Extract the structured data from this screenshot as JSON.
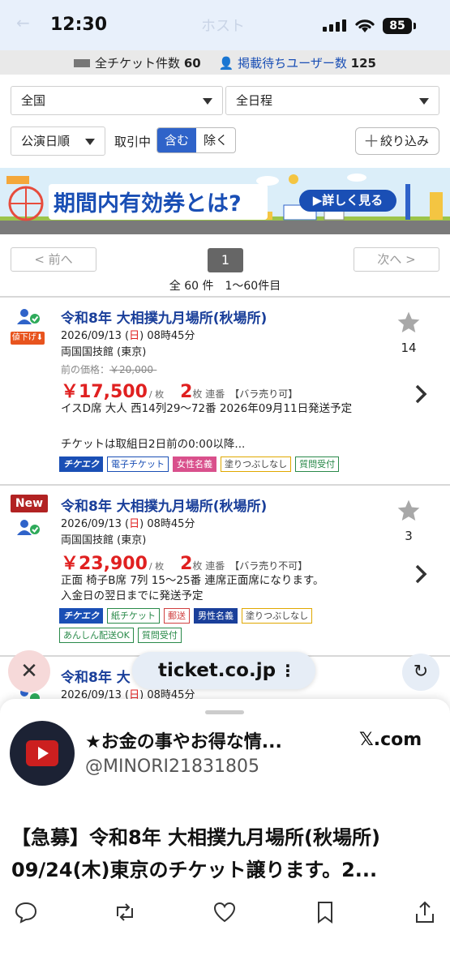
{
  "status_bar": {
    "time": "12:30",
    "battery": "85",
    "ghost_title": "ホスト"
  },
  "counts": {
    "total_label": "全チケット件数",
    "total": "60",
    "waiting_label": "掲載待ちユーザー数",
    "waiting": "125"
  },
  "filters": {
    "region": "全国",
    "schedule": "全日程",
    "sort": "公演日順",
    "trading_label": "取引中",
    "include": "含む",
    "exclude": "除く",
    "narrow": "絞り込み"
  },
  "banner": {
    "text": "期間内有効券とは?",
    "cta": "▶詳しく見る"
  },
  "pagination": {
    "prev": "< 前へ",
    "next": "次へ >",
    "page": "1",
    "info": "全 60 件　1〜60件目"
  },
  "listings": [
    {
      "badge": "値下げ⬇",
      "title": "令和8年 大相撲九月場所(秋場所)",
      "date": "2026/09/13 (",
      "day": "日",
      "time": ") 08時45分",
      "venue": "両国国技館 (東京)",
      "prev_label": "前の価格：",
      "prev_price": "￥20,000-",
      "price": "￥17,500",
      "per": "/ 枚",
      "qty": "2",
      "qty_unit": "枚 連番",
      "bara": "【バラ売り可】",
      "desc1": "イスD席 大人 西14列29〜72番 2026年09月11日発送予定",
      "desc2": "チケットは取組日2日前の0:00以降...",
      "tags": [
        {
          "label": "チケエク",
          "kind": "brand"
        },
        {
          "label": "電子チケット",
          "kind": "blue"
        },
        {
          "label": "女性名義",
          "kind": "pink"
        },
        {
          "label": "塗りつぶしなし",
          "kind": "yellow"
        },
        {
          "label": "質問受付",
          "kind": "green"
        }
      ],
      "favorites": "14"
    },
    {
      "badge": "New",
      "title": "令和8年 大相撲九月場所(秋場所)",
      "date": "2026/09/13 (",
      "day": "日",
      "time": ") 08時45分",
      "venue": "両国国技館 (東京)",
      "price": "￥23,900",
      "per": "/ 枚",
      "qty": "2",
      "qty_unit": "枚 連番",
      "bara": "【バラ売り不可】",
      "desc1": "正面 椅子B席 7列 15〜25番 連席正面席になります。",
      "desc2": "入金日の翌日までに発送予定",
      "tags": [
        {
          "label": "チケエク",
          "kind": "brand"
        },
        {
          "label": "紙チケット",
          "kind": "teal"
        },
        {
          "label": "郵送",
          "kind": "red"
        },
        {
          "label": "男性名義",
          "kind": "navy"
        },
        {
          "label": "塗りつぶしなし",
          "kind": "yellow"
        },
        {
          "label": "あんしん配送OK",
          "kind": "green"
        },
        {
          "label": "質問受付",
          "kind": "green"
        }
      ],
      "favorites": "3"
    },
    {
      "title": "令和8年 大",
      "date": "2026/09/13 (",
      "day": "日",
      "time": ") 08時45分"
    }
  ],
  "browser": {
    "url": "ticket.co.jp",
    "close": "✕",
    "menu": "⋮",
    "reload": "↻"
  },
  "share_sheet": {
    "account_name": "★お金の事やお得な情...",
    "handle": "@MINORI21831805",
    "source": "𝕏.com",
    "tweet_line1": "【急募】令和8年 大相撲九月場所(秋場所)",
    "tweet_line2": "09/24(木)東京のチケット譲ります。2..."
  },
  "colors": {
    "accent": "#2f63c9",
    "title": "#1a3f9a",
    "price": "#e02020",
    "new_badge": "#b22222"
  }
}
